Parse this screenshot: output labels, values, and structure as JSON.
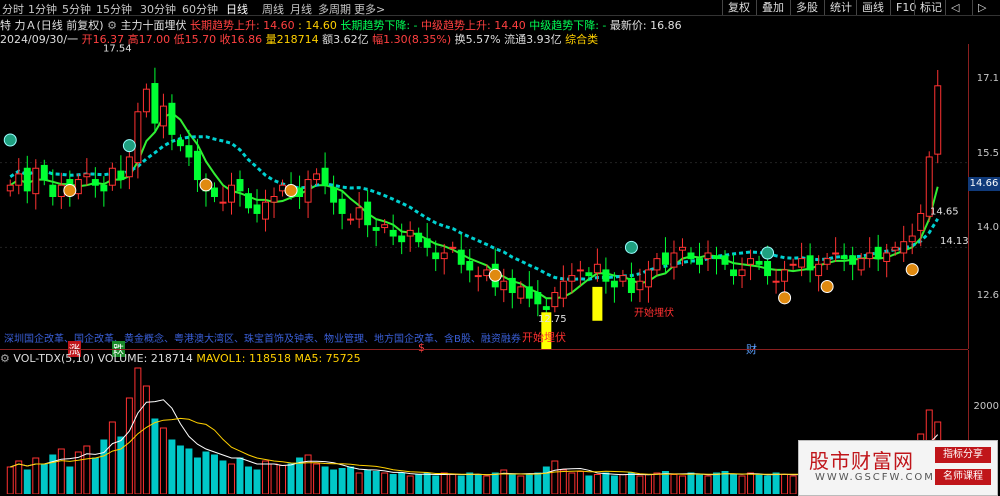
{
  "toolbar": {
    "periods": [
      "分时",
      "1分钟",
      "5分钟",
      "15分钟",
      "30分钟",
      "60分钟",
      "日线",
      "周线",
      "月线",
      "多周期",
      "更多>"
    ],
    "selected": "日线",
    "right_buttons": [
      "复权",
      "叠加",
      "多股",
      "统计",
      "画线",
      "F10",
      "标记",
      "◁",
      "▷"
    ]
  },
  "info1": {
    "name": "特 力Ａ(日线 前复权)",
    "indicator": "主力十面埋伏",
    "long_up": "长期趋势上升: 14.60",
    "long_up_val2": ": 14.60",
    "long_down": "长期趋势下降: -",
    "mid_up": "中级趋势上升: 14.40",
    "mid_down": "中级趋势下降: -",
    "latest": "最新价: 16.86"
  },
  "info2": {
    "date": "2024/09/30/一",
    "open": "开16.37",
    "high": "高17.00",
    "low": "低15.70",
    "close": "收16.86",
    "volume": "量218714",
    "amount": "额3.62亿",
    "change": "幅1.30(8.35%)",
    "turnover": "换5.57%",
    "float": "流通3.93亿",
    "sector": "综合类"
  },
  "annotations": {
    "high_label": "17.54",
    "low_label": "12.75",
    "right_label1": "14.65",
    "right_label2": "14.13",
    "bury1": "开始埋伏",
    "bury2": "开始埋伏",
    "tag_zhang": "涨",
    "tag_die": "跌",
    "tag_s": "$",
    "tag_cai": "财"
  },
  "news": "深圳国企改革、国企改革、黄金概念、粤港澳大湾区、珠宝首饰及钟表、物业管理、地方国企改革、含B股、融资融券",
  "y_axis_main": [
    "17.1",
    "15.5",
    "14.0",
    "12.6"
  ],
  "price_box": "14.66",
  "y_axis_vol": [
    "2000"
  ],
  "volume_info": {
    "name": "VOL-TDX(5,10)",
    "volume": "VOLUME: 218714",
    "mavol1": "MAVOL1: 118518",
    "ma5": "MA5: 75725"
  },
  "watermark": {
    "title": "股市财富网",
    "url": "WWW.GSCFW.COM",
    "btn1": "指标分享",
    "btn2": "名师课程"
  },
  "colors": {
    "up": "#ff3232",
    "down": "#00ff33",
    "cyan": "#00c8c8",
    "yellow": "#ffff00",
    "accent_red": "#c0151a"
  },
  "chart_data": {
    "type": "candlestick",
    "ylim": [
      12.2,
      17.6
    ],
    "series_count": 110,
    "closes": [
      15.1,
      15.3,
      15.0,
      15.4,
      15.2,
      14.9,
      15.1,
      15.0,
      15.2,
      15.3,
      15.1,
      15.0,
      15.4,
      15.2,
      15.6,
      16.4,
      16.8,
      16.2,
      16.5,
      16.0,
      15.8,
      15.6,
      15.2,
      15.0,
      14.9,
      14.8,
      15.1,
      15.0,
      14.7,
      14.6,
      14.8,
      14.9,
      15.1,
      15.0,
      14.9,
      15.2,
      15.3,
      15.1,
      14.8,
      14.6,
      14.5,
      14.7,
      14.4,
      14.3,
      14.4,
      14.2,
      14.1,
      14.3,
      14.1,
      14.0,
      13.8,
      13.9,
      14.0,
      13.7,
      13.6,
      13.5,
      13.6,
      13.3,
      13.4,
      13.2,
      13.3,
      13.1,
      13.0,
      12.9,
      13.2,
      13.4,
      13.5,
      13.6,
      13.5,
      13.7,
      13.4,
      13.3,
      13.5,
      13.2,
      13.4,
      13.6,
      13.8,
      13.7,
      13.9,
      14.0,
      13.8,
      13.7,
      13.9,
      13.8,
      13.7,
      13.5,
      13.6,
      13.8,
      13.7,
      13.5,
      13.4,
      13.6,
      13.7,
      13.8,
      13.6,
      13.7,
      13.8,
      13.9,
      13.8,
      13.7,
      13.8,
      13.9,
      13.8,
      13.9,
      14.0,
      14.1,
      14.2,
      14.6,
      15.6,
      16.86
    ],
    "volumes": [
      900,
      1100,
      800,
      1200,
      1000,
      1300,
      1500,
      900,
      1400,
      1600,
      1200,
      1800,
      2400,
      1900,
      3200,
      4200,
      3600,
      2500,
      2200,
      1800,
      1600,
      1500,
      1200,
      1400,
      1300,
      1100,
      1000,
      1200,
      900,
      800,
      1100,
      1000,
      950,
      1000,
      1200,
      1300,
      1000,
      900,
      800,
      850,
      900,
      700,
      800,
      750,
      700,
      650,
      700,
      600,
      650,
      700,
      600,
      700,
      650,
      600,
      700,
      650,
      600,
      700,
      800,
      650,
      600,
      650,
      700,
      900,
      1100,
      800,
      700,
      750,
      600,
      650,
      700,
      600,
      650,
      700,
      600,
      650,
      700,
      750,
      650,
      600,
      700,
      650,
      600,
      700,
      750,
      650,
      600,
      700,
      650,
      600,
      700,
      650,
      600,
      700,
      750,
      650,
      700,
      600,
      650,
      700,
      800,
      700,
      750,
      800,
      900,
      1200,
      1500,
      2000,
      2800,
      2400
    ]
  }
}
